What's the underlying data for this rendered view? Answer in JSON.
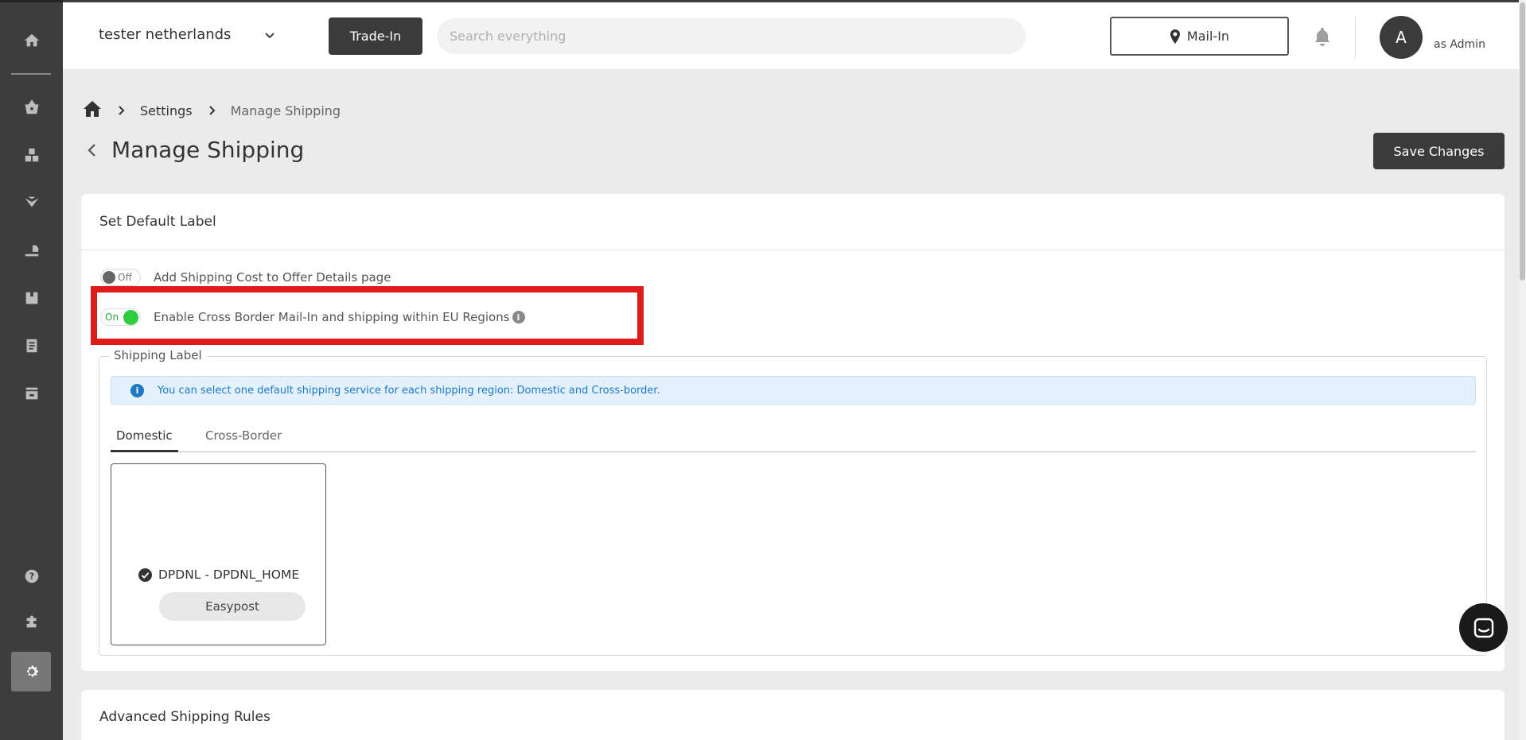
{
  "header": {
    "store_name": "tester netherlands",
    "tradein_label": "Trade-In",
    "search_placeholder": "Search everything",
    "mailin_label": "Mail-In",
    "avatar_initial": "A",
    "role_label": "as Admin"
  },
  "sidebar": {
    "items": [
      {
        "icon": "home-icon"
      },
      {
        "icon": "basket-icon"
      },
      {
        "icon": "inventory-icon"
      },
      {
        "icon": "orders-icon"
      },
      {
        "icon": "shipping-icon"
      },
      {
        "icon": "box-icon"
      },
      {
        "icon": "reports-icon"
      },
      {
        "icon": "store-icon"
      },
      {
        "icon": "help-icon"
      },
      {
        "icon": "plugin-icon"
      },
      {
        "icon": "settings-icon",
        "active": true
      }
    ]
  },
  "breadcrumb": {
    "settings": "Settings",
    "current": "Manage Shipping"
  },
  "page": {
    "title": "Manage Shipping",
    "save_label": "Save Changes"
  },
  "default_label": {
    "title": "Set Default Label",
    "toggle_shipping_cost": {
      "state": "Off",
      "label": "Add Shipping Cost to Offer Details page"
    },
    "toggle_cross_border": {
      "state": "On",
      "label": "Enable Cross Border Mail-In and shipping within EU Regions"
    },
    "info_glyph": "i",
    "fieldset_legend": "Shipping Label",
    "notice": "You can select one default shipping service for each shipping region: Domestic and Cross-border.",
    "tabs": [
      {
        "label": "Domestic",
        "active": true
      },
      {
        "label": "Cross-Border",
        "active": false
      }
    ],
    "service": {
      "name": "DPDNL - DPDNL_HOME",
      "provider": "Easypost"
    }
  },
  "advanced": {
    "title": "Advanced Shipping Rules"
  },
  "colors": {
    "accent_dark": "#3b3b3b",
    "highlight_red": "#e01b1b",
    "toggle_on_green": "#2ecc40",
    "notice_blue": "#1f78c8"
  }
}
